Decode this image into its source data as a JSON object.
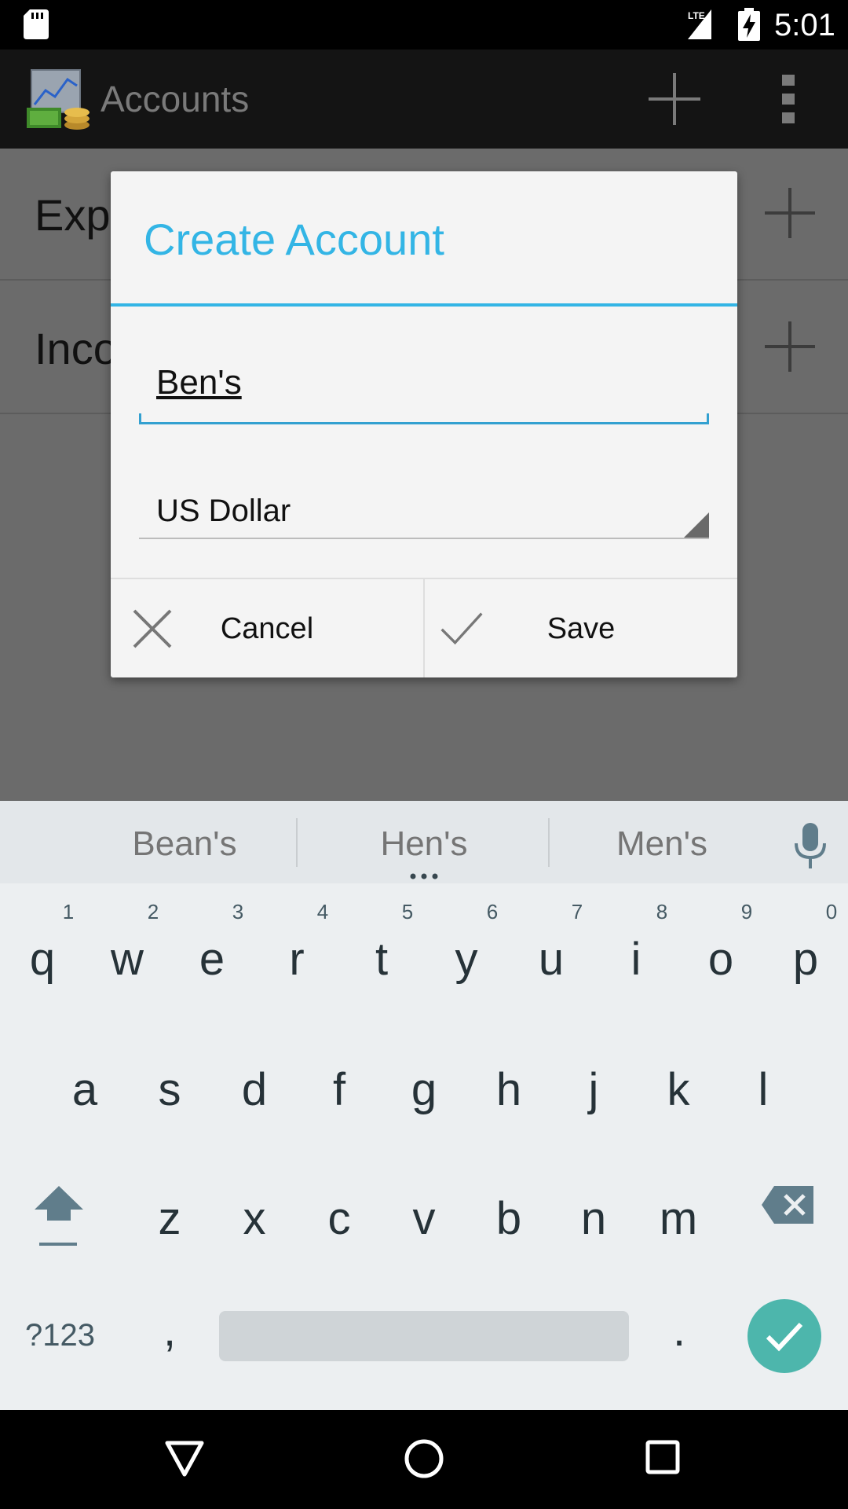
{
  "status_bar": {
    "time": "5:01",
    "network": "LTE",
    "icons": [
      "sd-card-icon",
      "lte-signal-icon",
      "battery-charging-icon"
    ]
  },
  "app_bar": {
    "title": "Accounts",
    "icons": [
      "app-logo-icon",
      "add-icon",
      "overflow-menu-icon"
    ]
  },
  "list": {
    "rows": [
      {
        "label": "Exp"
      },
      {
        "label": "Inco"
      }
    ]
  },
  "dialog": {
    "title": "Create Account",
    "name_value": "Ben's",
    "currency_value": "US Dollar",
    "cancel_label": "Cancel",
    "save_label": "Save",
    "accent_color": "#33b5e5"
  },
  "keyboard": {
    "suggestions": [
      "Bean's",
      "Hen's",
      "Men's"
    ],
    "row1": [
      "q",
      "w",
      "e",
      "r",
      "t",
      "y",
      "u",
      "i",
      "o",
      "p"
    ],
    "row1_hints": [
      "1",
      "2",
      "3",
      "4",
      "5",
      "6",
      "7",
      "8",
      "9",
      "0"
    ],
    "row2": [
      "a",
      "s",
      "d",
      "f",
      "g",
      "h",
      "j",
      "k",
      "l"
    ],
    "row3": [
      "z",
      "x",
      "c",
      "v",
      "b",
      "n",
      "m"
    ],
    "symbols_label": "?123",
    "comma": ",",
    "period": ".",
    "enter_color": "#4db6ac"
  },
  "nav_bar": {
    "icons": [
      "back-icon",
      "home-icon",
      "recents-icon"
    ]
  }
}
